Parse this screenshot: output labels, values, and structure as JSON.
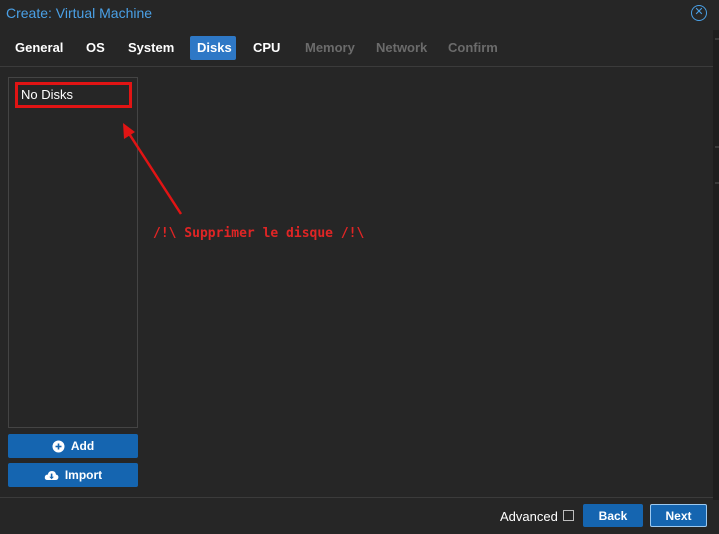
{
  "window": {
    "title": "Create: Virtual Machine",
    "close_icon": "close-circle-icon"
  },
  "tabs": [
    {
      "label": "General",
      "state": "enabled"
    },
    {
      "label": "OS",
      "state": "enabled"
    },
    {
      "label": "System",
      "state": "enabled"
    },
    {
      "label": "Disks",
      "state": "active"
    },
    {
      "label": "CPU",
      "state": "enabled"
    },
    {
      "label": "Memory",
      "state": "disabled"
    },
    {
      "label": "Network",
      "state": "disabled"
    },
    {
      "label": "Confirm",
      "state": "disabled"
    }
  ],
  "disks": {
    "empty_label": "No Disks",
    "add_label": "Add",
    "add_icon": "plus-circle-icon",
    "import_label": "Import",
    "import_icon": "cloud-download-icon"
  },
  "annotation": {
    "text": "/!\\ Supprimer le disque /!\\",
    "color": "#e02525"
  },
  "footer": {
    "advanced_label": "Advanced",
    "advanced_checked": false,
    "back_label": "Back",
    "next_label": "Next"
  },
  "colors": {
    "accent": "#2e78c6",
    "button": "#1565b0",
    "title": "#4aa0e6",
    "background": "#262626"
  }
}
